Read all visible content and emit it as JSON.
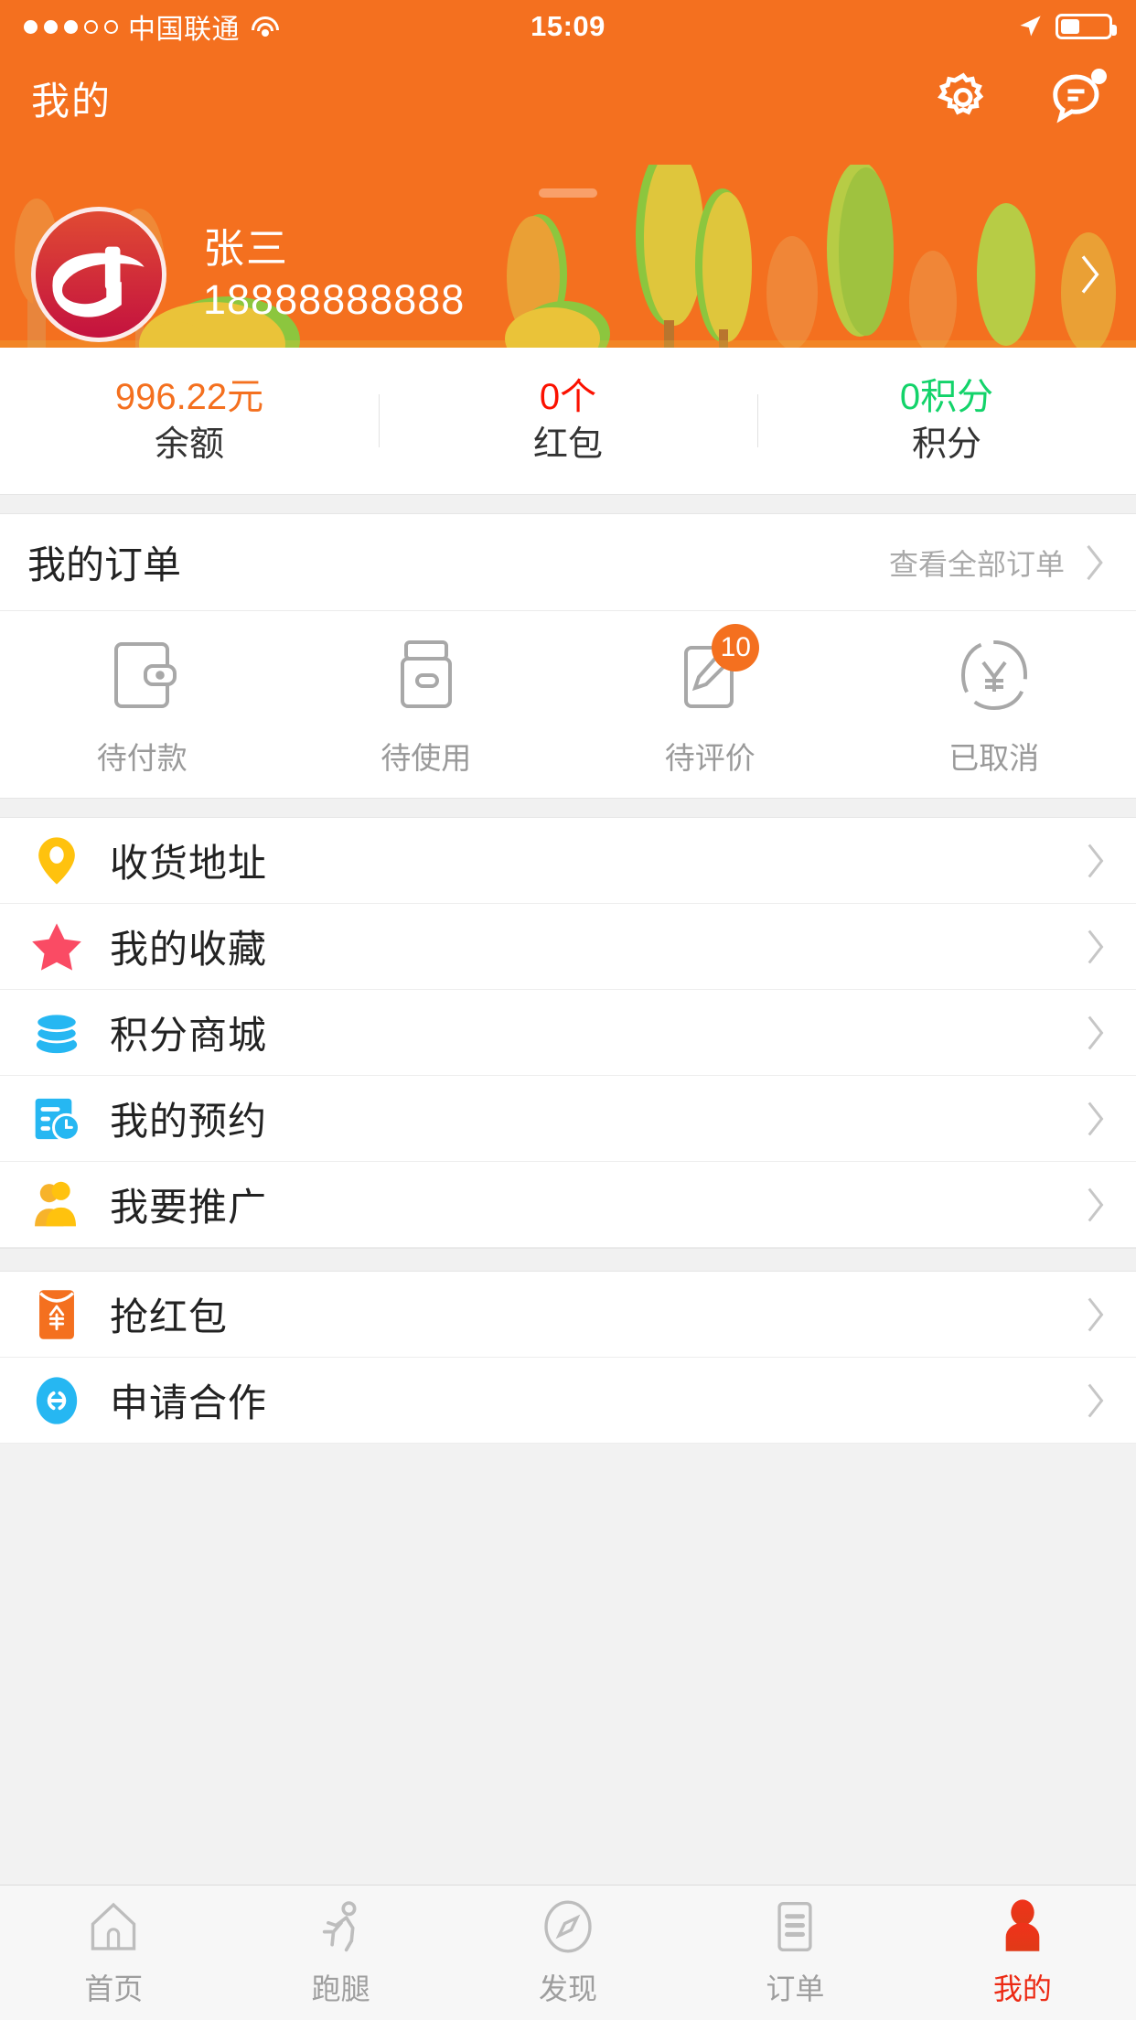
{
  "status_bar": {
    "carrier": "中国联通",
    "time": "15:09",
    "signal_dots_filled": 3,
    "signal_dots_total": 5,
    "battery_percent": 40
  },
  "header": {
    "title": "我的",
    "gear_icon": "gear-icon",
    "message_icon": "message-icon",
    "user": {
      "name": "张三",
      "phone": "18888888888"
    },
    "accent_color": "#f4701f"
  },
  "stats": [
    {
      "value": "996.22元",
      "label": "余额",
      "color": "#f4701f"
    },
    {
      "value": "0个",
      "label": "红包",
      "color": "#fb1100"
    },
    {
      "value": "0积分",
      "label": "积分",
      "color": "#13d36a"
    }
  ],
  "orders": {
    "title": "我的订单",
    "view_all": "查看全部订单",
    "items": [
      {
        "label": "待付款",
        "icon": "wallet-icon",
        "badge": ""
      },
      {
        "label": "待使用",
        "icon": "ticket-icon",
        "badge": ""
      },
      {
        "label": "待评价",
        "icon": "review-icon",
        "badge": "10"
      },
      {
        "label": "已取消",
        "icon": "refund-icon",
        "badge": ""
      }
    ]
  },
  "menu_groups": [
    {
      "items": [
        {
          "label": "收货地址",
          "icon": "location-pin-icon",
          "color": "#ffc20e"
        },
        {
          "label": "我的收藏",
          "icon": "star-icon",
          "color": "#fa4b64"
        },
        {
          "label": "积分商城",
          "icon": "coins-icon",
          "color": "#26b7f2"
        },
        {
          "label": "我的预约",
          "icon": "calendar-clock-icon",
          "color": "#26b7f2"
        },
        {
          "label": "我要推广",
          "icon": "promote-users-icon",
          "color": "#ffc20e"
        }
      ]
    },
    {
      "items": [
        {
          "label": "抢红包",
          "icon": "red-packet-icon",
          "color": "#f4701f"
        },
        {
          "label": "申请合作",
          "icon": "link-circle-icon",
          "color": "#26b7f2"
        }
      ]
    }
  ],
  "tabbar": {
    "active_color": "#ec2a14",
    "items": [
      {
        "label": "首页",
        "icon": "home-icon",
        "active": false
      },
      {
        "label": "跑腿",
        "icon": "runner-icon",
        "active": false
      },
      {
        "label": "发现",
        "icon": "compass-icon",
        "active": false
      },
      {
        "label": "订单",
        "icon": "list-icon",
        "active": false
      },
      {
        "label": "我的",
        "icon": "person-icon",
        "active": true
      }
    ]
  }
}
